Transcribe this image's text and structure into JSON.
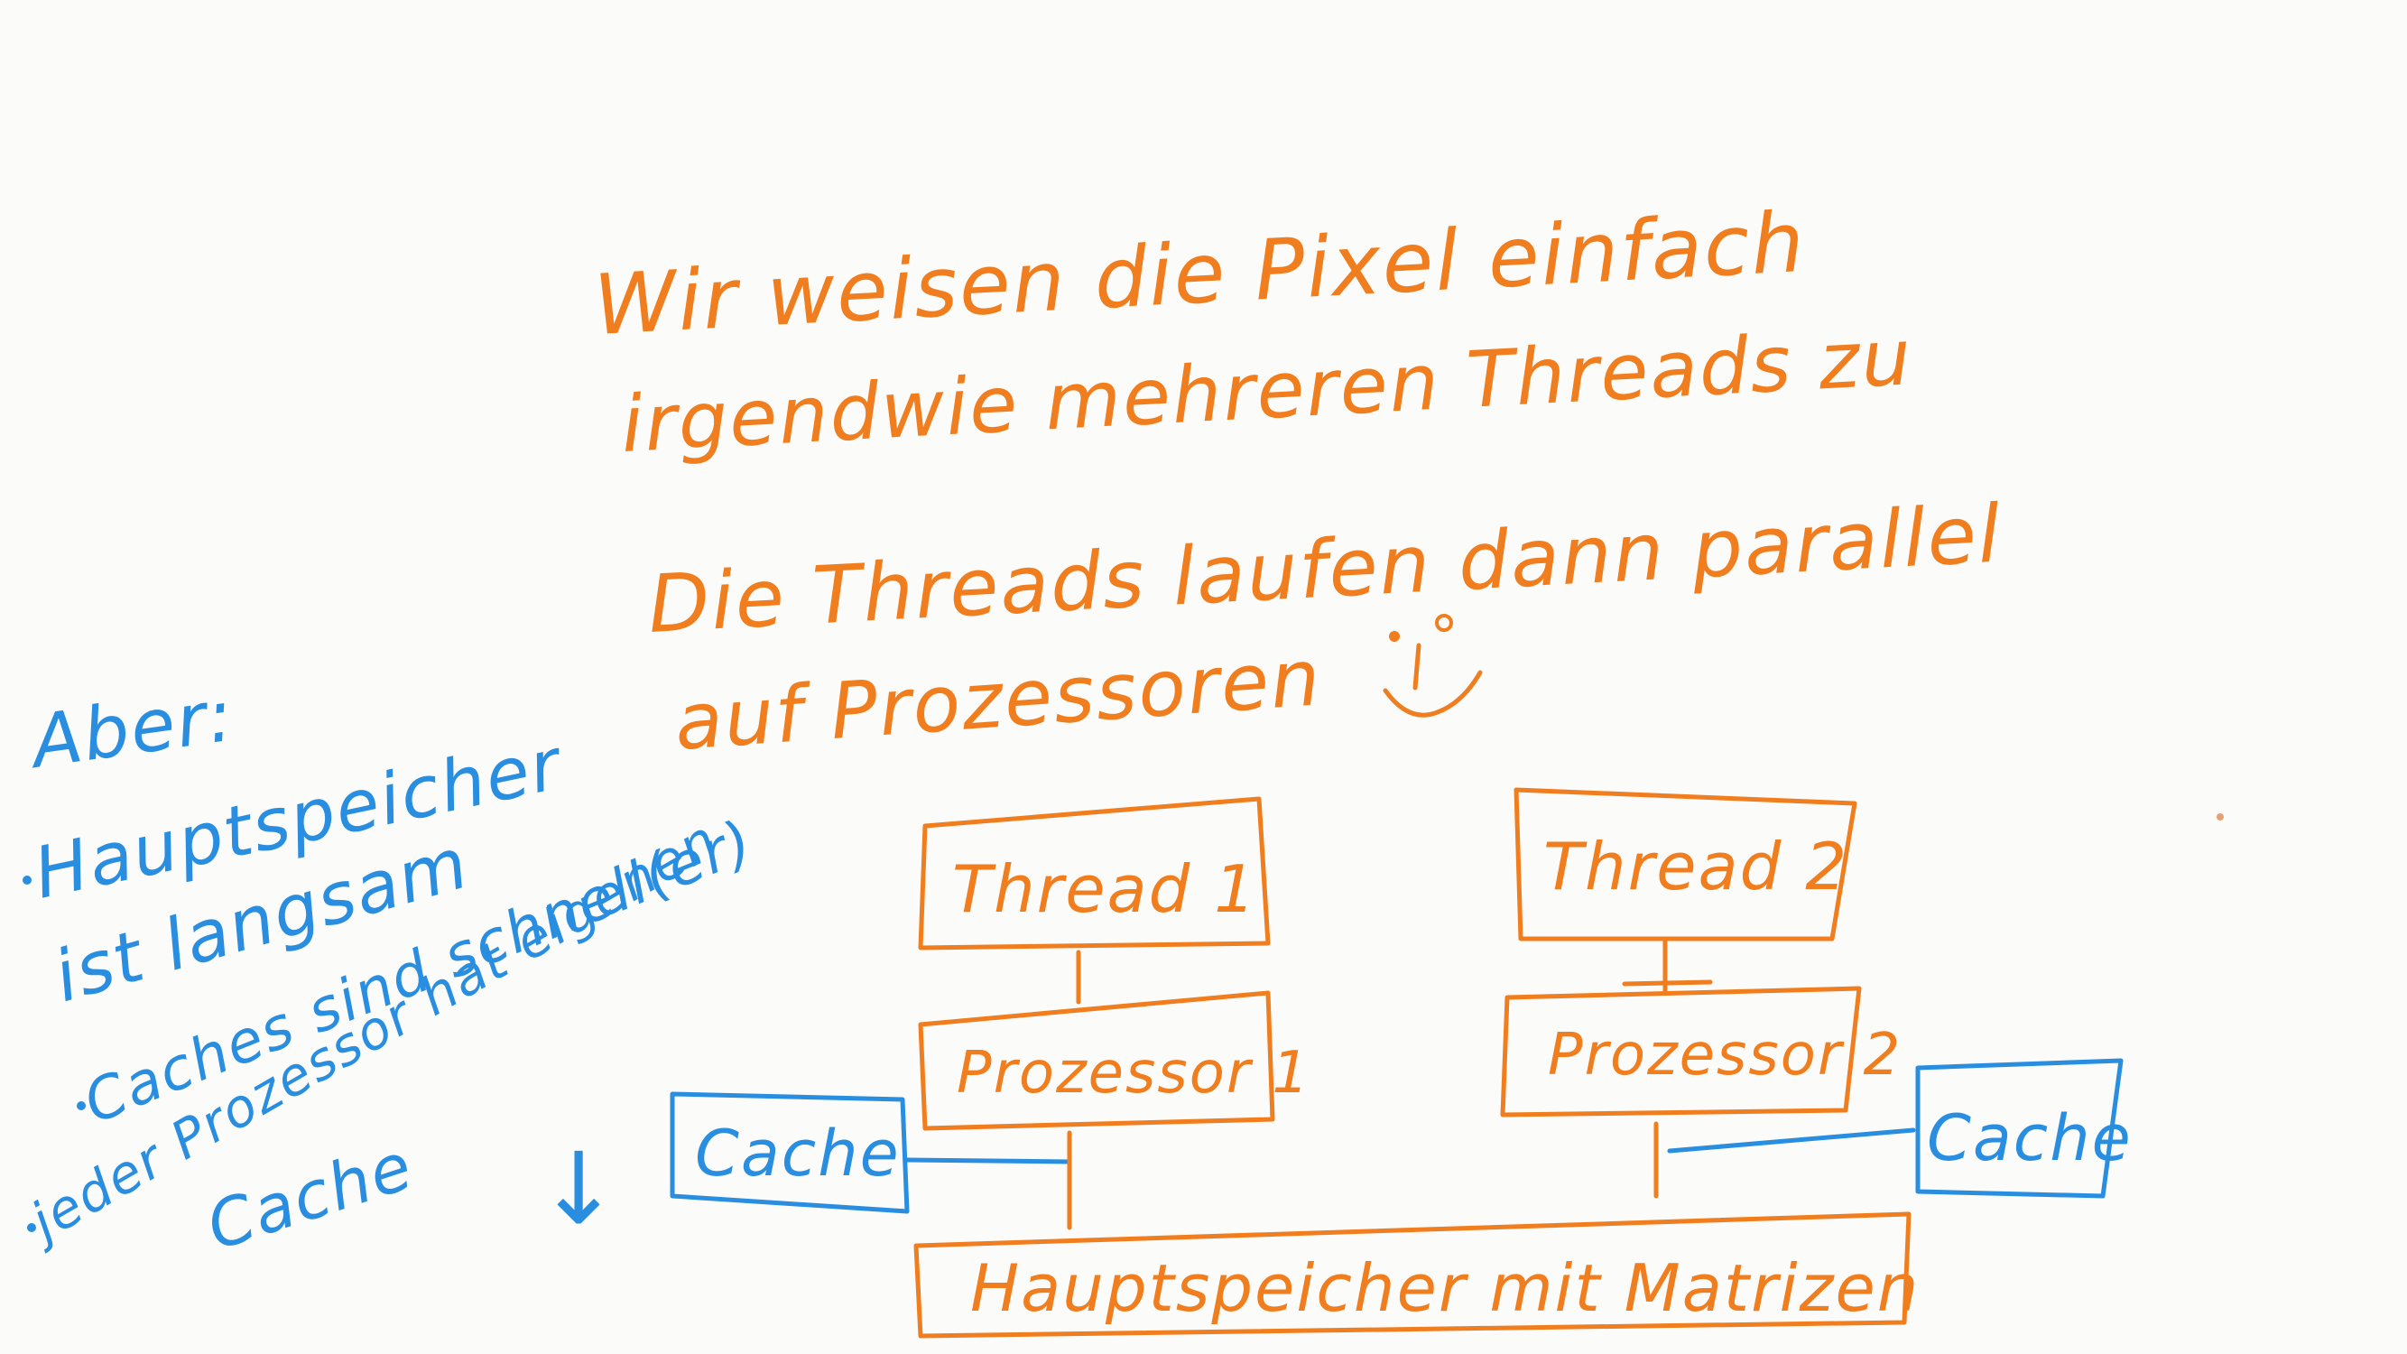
{
  "colors": {
    "ink_orange": "#f07d1e",
    "ink_blue": "#2a8ee0",
    "paper": "#fbfbfa"
  },
  "notes": {
    "line1": "Wir weisen die Pixel einfach",
    "line2": "irgendwie mehreren Threads zu",
    "line3": "Die Threads laufen dann parallel",
    "line4": "auf Prozessoren",
    "smiley": ":)"
  },
  "aside": {
    "heading": "Aber:",
    "bullet1_a": "Hauptspeicher",
    "bullet1_b": "ist langsam",
    "bullet2": "Caches sind schnell(er)",
    "bullet3_a": "jeder Prozessor hat eigenen",
    "bullet3_b": "Cache",
    "bullet3_mark": "↓"
  },
  "diagram": {
    "thread1": "Thread 1",
    "thread2": "Thread 2",
    "proc1": "Prozessor 1",
    "proc2": "Prozessor 2",
    "cache_left": "Cache",
    "cache_right": "Cache",
    "memory": "Hauptspeicher mit Matrizen"
  }
}
